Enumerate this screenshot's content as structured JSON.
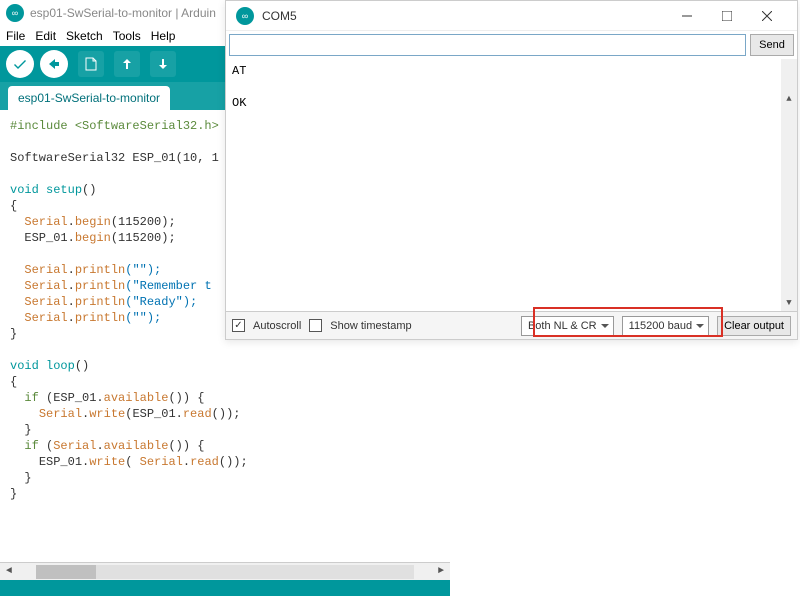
{
  "ide": {
    "title": "esp01-SwSerial-to-monitor | Arduin",
    "menus": [
      "File",
      "Edit",
      "Sketch",
      "Tools",
      "Help"
    ],
    "tab": "esp01-SwSerial-to-monitor",
    "code": {
      "inc": "#include",
      "inc_arg": "<SoftwareSerial32.h>",
      "decl": "SoftwareSerial32 ESP_01(10, 1",
      "void": "void",
      "setup": "setup",
      "loop": "loop",
      "serial": "Serial",
      "begin": "begin",
      "println": "println",
      "write": "write",
      "read": "read",
      "available": "available",
      "esp": "ESP_01",
      "n115200": "(115200);",
      "empty": "(\"\");",
      "remember": "(\"Remember t",
      "ready": "(\"Ready\");",
      "if": "if",
      "if_esp": " (ESP_01.",
      "if_ser": " (",
      "paren_empty": "()) {",
      "write_esp": "(ESP_01.",
      "write_ser": "( ",
      "read_end": "());"
    }
  },
  "serial": {
    "title": "COM5",
    "send": "Send",
    "output": "AT\n\nOK",
    "autoscroll": "Autoscroll",
    "timestamp": "Show timestamp",
    "lineending": "Both NL & CR",
    "baud": "115200 baud",
    "clear": "Clear output"
  }
}
